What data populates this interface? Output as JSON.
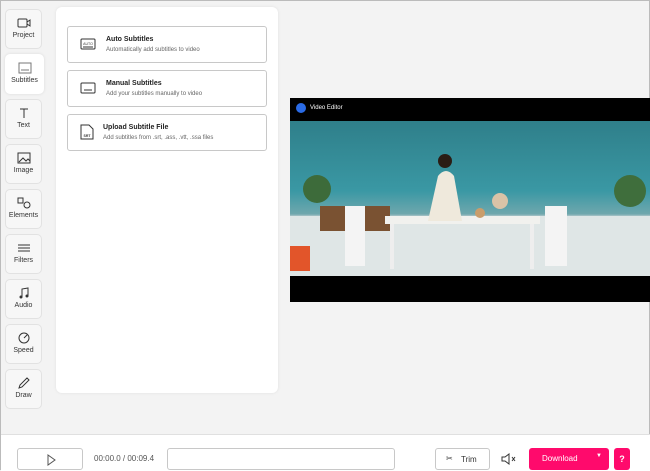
{
  "sidebar": {
    "items": [
      {
        "label": "Project",
        "icon": "video-camera-icon"
      },
      {
        "label": "Subtitles",
        "icon": "subtitles-icon",
        "active": true
      },
      {
        "label": "Text",
        "icon": "text-icon"
      },
      {
        "label": "Image",
        "icon": "image-icon"
      },
      {
        "label": "Elements",
        "icon": "shapes-icon"
      },
      {
        "label": "Filters",
        "icon": "sliders-icon"
      },
      {
        "label": "Audio",
        "icon": "music-note-icon"
      },
      {
        "label": "Speed",
        "icon": "speedometer-icon"
      },
      {
        "label": "Draw",
        "icon": "pen-icon"
      }
    ]
  },
  "panel": {
    "cards": [
      {
        "title": "Auto Subtitles",
        "desc": "Automatically add subtitles to video",
        "icon_text": "AUTO"
      },
      {
        "title": "Manual Subtitles",
        "desc": "Add your subtitles manually to video"
      },
      {
        "title": "Upload Subtitle File",
        "desc": "Add subtitles from .srt, .ass, .vtt, .ssa files",
        "icon_text": "SRT"
      }
    ]
  },
  "video": {
    "watermark": "Video Editor"
  },
  "controls": {
    "time": "00:00.0 / 00:09.4",
    "trim": "Trim",
    "download": "Download",
    "help": "?"
  },
  "colors": {
    "accent": "#ff0a6c"
  }
}
